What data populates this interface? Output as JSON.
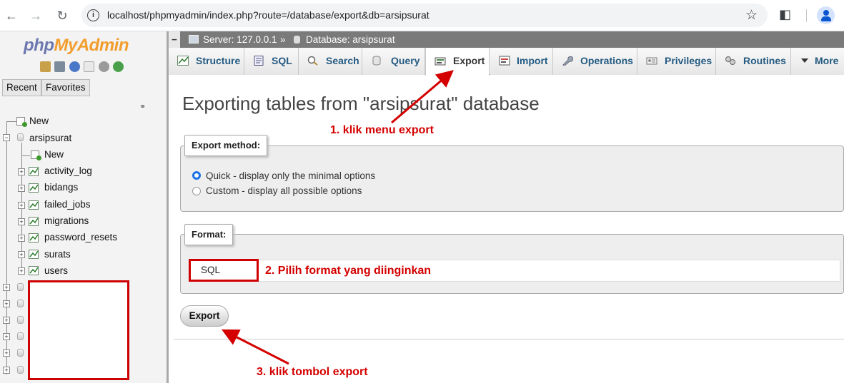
{
  "browser": {
    "url": "localhost/phpmyadmin/index.php?route=/database/export&db=arsipsurat"
  },
  "sidebar": {
    "logo_php": "php",
    "logo_rest": "MyAdmin",
    "tabs": [
      "Recent",
      "Favorites"
    ],
    "tree": {
      "new_root": "New",
      "database": "arsipsurat",
      "new_table": "New",
      "tables": [
        "activity_log",
        "bidangs",
        "failed_jobs",
        "migrations",
        "password_resets",
        "surats",
        "users"
      ]
    }
  },
  "breadcrumb": {
    "server": "Server: 127.0.0.1",
    "separator": "»",
    "database": "Database: arsipsurat"
  },
  "tabs": [
    {
      "label": "Structure",
      "icon": "structure-icon"
    },
    {
      "label": "SQL",
      "icon": "sql-icon"
    },
    {
      "label": "Search",
      "icon": "search-icon"
    },
    {
      "label": "Query",
      "icon": "query-icon"
    },
    {
      "label": "Export",
      "icon": "export-icon",
      "active": true
    },
    {
      "label": "Import",
      "icon": "import-icon"
    },
    {
      "label": "Operations",
      "icon": "wrench-icon"
    },
    {
      "label": "Privileges",
      "icon": "privileges-icon"
    },
    {
      "label": "Routines",
      "icon": "routines-icon"
    },
    {
      "label": "More",
      "icon": "chevron-down-icon"
    }
  ],
  "main": {
    "title": "Exporting tables from \"arsipsurat\" database",
    "export_method": {
      "legend": "Export method:",
      "options": [
        {
          "label": "Quick - display only the minimal options",
          "checked": true
        },
        {
          "label": "Custom - display all possible options",
          "checked": false
        }
      ]
    },
    "format": {
      "legend": "Format:",
      "value": "SQL"
    },
    "export_button": "Export"
  },
  "annotations": {
    "step1": "1. klik menu export",
    "step2": "2. Pilih format yang diinginkan",
    "step3": "3. klik tombol export"
  },
  "colors": {
    "annotation_red": "#d40000",
    "logo_blue": "#6c78af",
    "logo_orange": "#f29d2d",
    "tab_link": "#235a81"
  }
}
